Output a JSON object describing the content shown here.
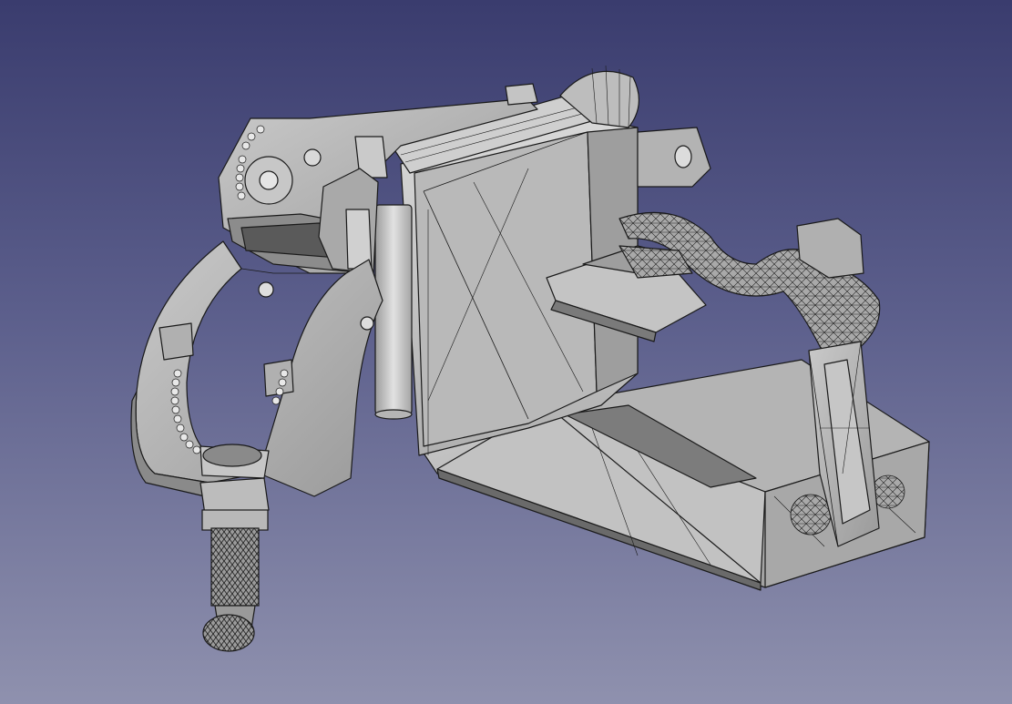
{
  "viewport": {
    "background_top": "#3a3c6e",
    "background_bottom": "#8f91ae",
    "model_face_color": "#b8b8b8",
    "model_edge_color": "#1a1a1a"
  },
  "model": {
    "render_mode": "shaded-with-edges",
    "parts": [
      "clamp-ring",
      "knurled-screw",
      "upright-back-panel",
      "base-tray",
      "gripper-arm",
      "top-hinge-block",
      "cylinder-post"
    ]
  }
}
